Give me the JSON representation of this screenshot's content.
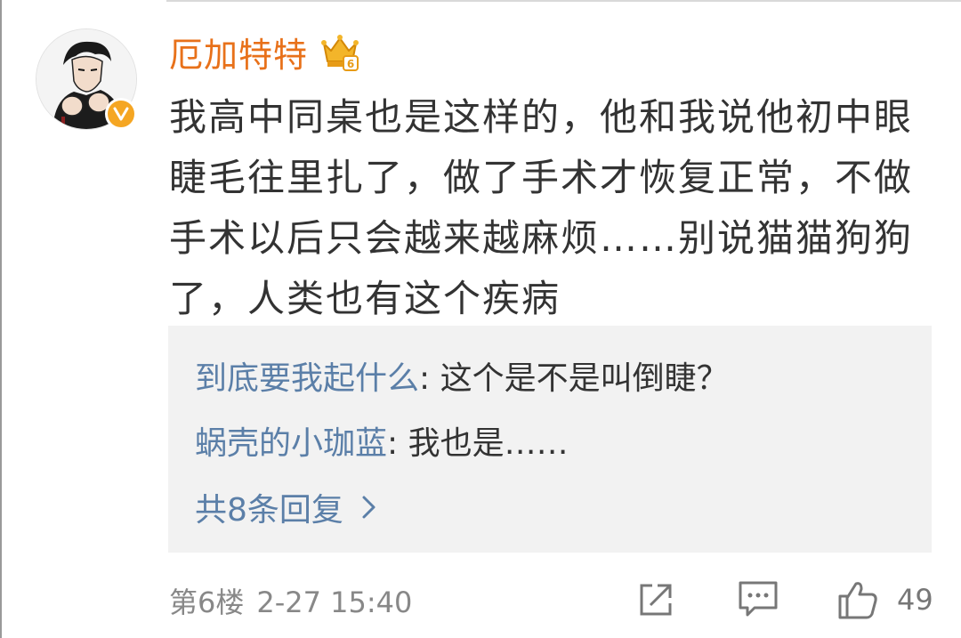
{
  "comment": {
    "username": "厄加特特",
    "text": "我高中同桌也是这样的，他和我说他初中眼睫毛往里扎了，做了手术才恢复正常，不做手术以后只会越来越麻烦……别说猫猫狗狗了，人类也有这个疾病",
    "floor": "第6楼",
    "time": "2-27 15:40",
    "like_count": "49",
    "crown_level": "6"
  },
  "replies": [
    {
      "name": "到底要我起什么",
      "separator": ": ",
      "text": "这个是不是叫倒睫？"
    },
    {
      "name": "蜗壳的小珈蓝",
      "separator": ": ",
      "text": "我也是……"
    }
  ],
  "more_replies": "共8条回复",
  "colors": {
    "username": "#e8711a",
    "reply_name": "#5b7fa8",
    "text": "#333333",
    "meta": "#888888",
    "reply_bg": "#f2f2f2",
    "verified": "#f5a623"
  },
  "icons": {
    "verified": "verified-v-icon",
    "crown": "crown-icon",
    "share": "share-icon",
    "reply": "comment-icon",
    "like": "thumbs-up-icon",
    "more": "chevron-right-icon"
  }
}
